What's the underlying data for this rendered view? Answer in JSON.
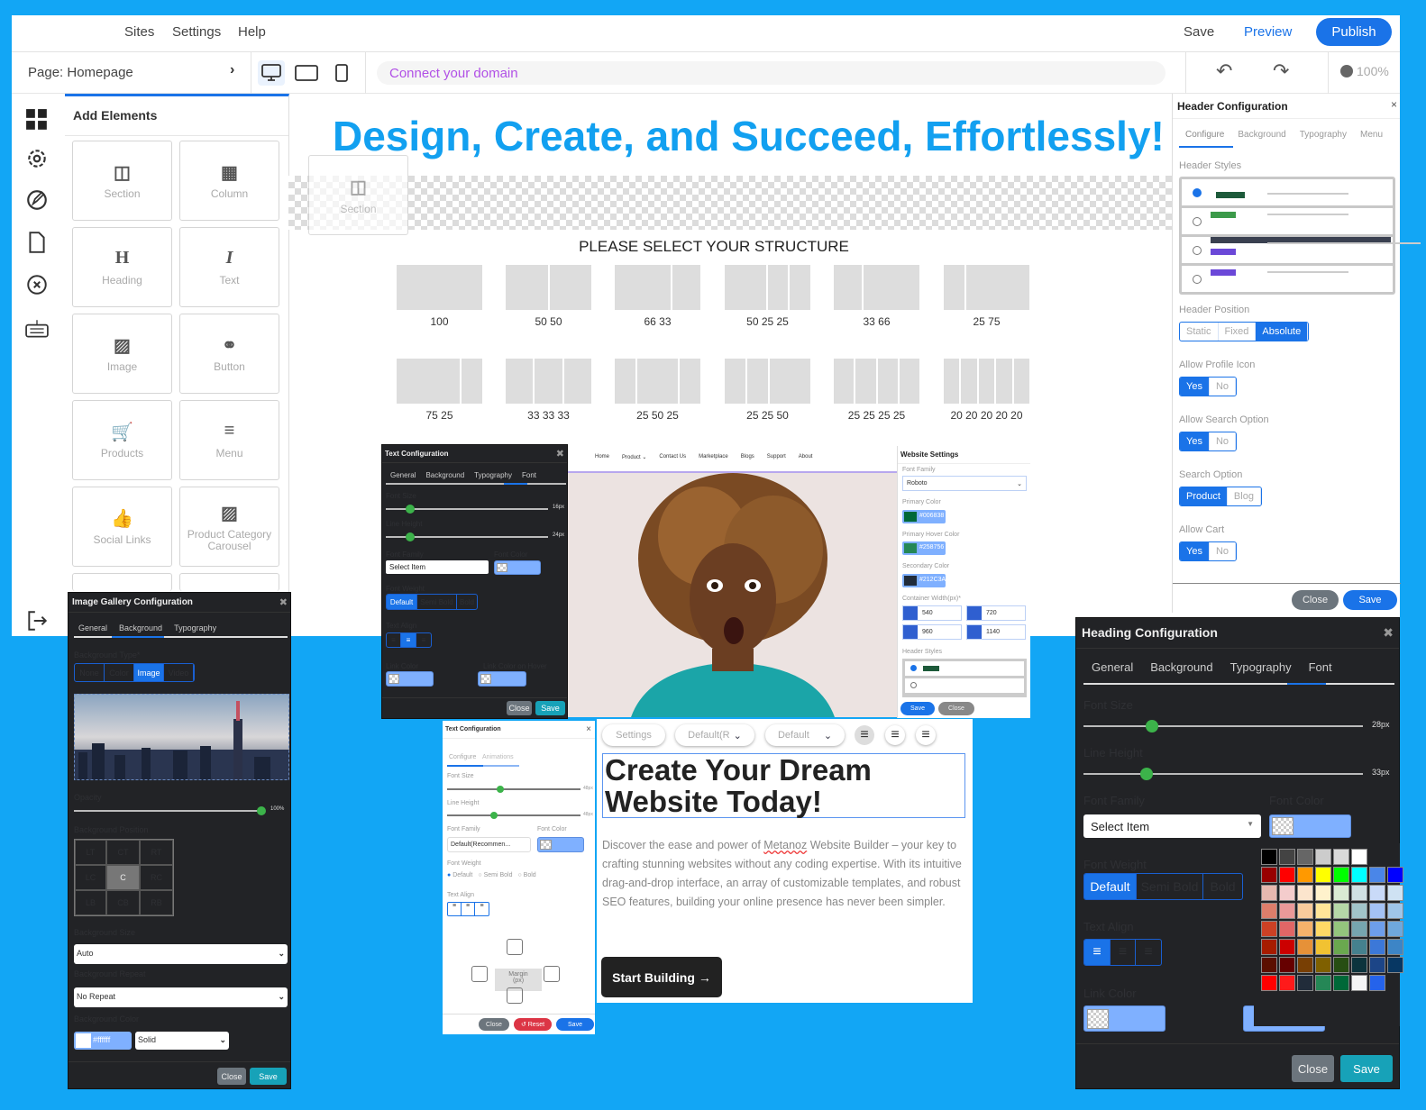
{
  "colors": {
    "background": "#12a6f5",
    "accent": "#1a73e8",
    "heading": "#12a0f0",
    "domain_text": "#b150e6"
  },
  "topbar": {
    "menu": [
      "Sites",
      "Settings",
      "Help"
    ],
    "save": "Save",
    "preview": "Preview",
    "publish": "Publish"
  },
  "secbar": {
    "page": "Page: Homepage",
    "domain": "Connect your domain",
    "zoom": "100%"
  },
  "add_elements": {
    "title": "Add Elements",
    "tiles": [
      {
        "label": "Section",
        "icon": "section-icon",
        "glyph": "◫"
      },
      {
        "label": "Column",
        "icon": "column-icon",
        "glyph": "▦"
      },
      {
        "label": "Heading",
        "icon": "heading-icon",
        "glyph": "H"
      },
      {
        "label": "Text",
        "icon": "text-icon",
        "glyph": "I"
      },
      {
        "label": "Image",
        "icon": "image-icon",
        "glyph": "▨"
      },
      {
        "label": "Button",
        "icon": "link-icon",
        "glyph": "⚭"
      },
      {
        "label": "Products",
        "icon": "cart-icon",
        "glyph": "🛒"
      },
      {
        "label": "Menu",
        "icon": "menu-icon",
        "glyph": "≡"
      },
      {
        "label": "Social Links",
        "icon": "thumbs-up-icon",
        "glyph": "👍"
      },
      {
        "label": "Product Category Carousel",
        "icon": "images-icon",
        "glyph": "▨"
      }
    ]
  },
  "canvas": {
    "headline": "Design, Create, and Succeed, Effortlessly!",
    "ghost_section": "Section",
    "structure_title": "PLEASE SELECT YOUR STRUCTURE",
    "structures": [
      {
        "label": "100",
        "cols": [
          100
        ]
      },
      {
        "label": "50 50",
        "cols": [
          50,
          50
        ]
      },
      {
        "label": "66 33",
        "cols": [
          66,
          33
        ]
      },
      {
        "label": "50 25 25",
        "cols": [
          50,
          25,
          25
        ]
      },
      {
        "label": "33 66",
        "cols": [
          33,
          66
        ]
      },
      {
        "label": "25 75",
        "cols": [
          25,
          75
        ]
      },
      {
        "label": "75 25",
        "cols": [
          75,
          25
        ]
      },
      {
        "label": "33 33 33",
        "cols": [
          33,
          33,
          33
        ]
      },
      {
        "label": "25 50 25",
        "cols": [
          25,
          50,
          25
        ]
      },
      {
        "label": "25 25 50",
        "cols": [
          25,
          25,
          50
        ]
      },
      {
        "label": "25 25 25 25",
        "cols": [
          25,
          25,
          25,
          25
        ]
      },
      {
        "label": "20 20 20 20 20",
        "cols": [
          20,
          20,
          20,
          20,
          20
        ]
      }
    ]
  },
  "text_config_dark": {
    "title": "Text Configuration",
    "tabs": [
      "General",
      "Background",
      "Typography",
      "Font"
    ],
    "active_tab": "Font",
    "font_size_label": "Font Size",
    "font_size": "16px",
    "line_height_label": "Line Height",
    "line_height": "24px",
    "font_family_label": "Font Family",
    "font_family": "Select Item",
    "font_color_label": "Font Color",
    "font_weight_label": "Font Weight",
    "weights": [
      "Default",
      "Semi Bold",
      "Bold"
    ],
    "text_align_label": "Text Align",
    "link_color_label": "Link Color",
    "link_hover_label": "Link Color on Hover",
    "close": "Close",
    "save": "Save"
  },
  "preview_nav": [
    "Home",
    "Product ⌄",
    "Contact Us",
    "Marketplace",
    "Blogs",
    "Support",
    "About"
  ],
  "website_settings": {
    "title": "Website Settings",
    "font_family_label": "Font Family",
    "font_family": "Roboto",
    "primary_label": "Primary Color",
    "primary": "#006838",
    "hover_label": "Primary Hover Color",
    "hover": "#258756",
    "secondary_label": "Secondary Color",
    "secondary": "#212C3A",
    "container_label": "Container Width(px)*",
    "widths": [
      "540",
      "720",
      "960",
      "1140"
    ],
    "header_styles_label": "Header Styles",
    "save": "Save",
    "close": "Close"
  },
  "gallery_config": {
    "title": "Image Gallery Configuration",
    "tabs": [
      "General",
      "Background",
      "Typography"
    ],
    "active_tab": "Background",
    "bg_type_label": "Background Type*",
    "bg_types": [
      "None",
      "Color",
      "Image",
      "Video"
    ],
    "bg_type": "Image",
    "opacity_label": "Opacity",
    "opacity": "100%",
    "position_label": "Background Position",
    "positions": [
      "LT",
      "CT",
      "RT",
      "LC",
      "C",
      "RC",
      "LB",
      "CB",
      "RB"
    ],
    "position": "C",
    "size_label": "Background Size",
    "size": "Auto",
    "repeat_label": "Background Repeat",
    "repeat": "No Repeat",
    "color_label": "Background Color",
    "color": "#ffffff",
    "color_style": "Solid",
    "close": "Close",
    "save": "Save"
  },
  "text_config_light": {
    "title": "Text Configuration",
    "tabs": [
      "Configure",
      "Animations"
    ],
    "font_size_label": "Font Size",
    "font_size": "48px",
    "line_height_label": "Line Height",
    "line_height": "48px",
    "font_family_label": "Font Family",
    "font_family": "Default(Recommen...",
    "font_color_label": "Font Color",
    "font_weight_label": "Font Weight",
    "weights": [
      "Default",
      "Semi Bold",
      "Bold"
    ],
    "text_align_label": "Text Align",
    "margin": "Margin",
    "margin_unit": "(px)",
    "close": "Close",
    "reset": "Reset",
    "save": "Save"
  },
  "hero": {
    "toolbar": {
      "settings": "Settings",
      "font": "Default(R",
      "weight": "Default"
    },
    "title": "Create Your Dream Website Today!",
    "body_pre": "Discover the ease and power of ",
    "brand": "Metanoz",
    "body_post": " Website Builder – your key to crafting stunning websites without any coding expertise. With its intuitive drag-and-drop interface, an array of customizable templates, and robust SEO features, building your online presence has never been simpler.",
    "cta": "Start Building"
  },
  "header_config": {
    "title": "Header Configuration",
    "tabs": [
      "Configure",
      "Background",
      "Typography",
      "Menu"
    ],
    "styles_label": "Header Styles",
    "position_label": "Header Position",
    "positions": [
      "Static",
      "Fixed",
      "Absolute"
    ],
    "position": "Absolute",
    "profile_label": "Allow Profile Icon",
    "search_label": "Allow Search Option",
    "search_option_label": "Search Option",
    "search_options": [
      "Product",
      "Blog"
    ],
    "cart_label": "Allow Cart",
    "yes": "Yes",
    "no": "No",
    "close": "Close",
    "save": "Save"
  },
  "heading_config": {
    "title": "Heading Configuration",
    "tabs": [
      "General",
      "Background",
      "Typography",
      "Font"
    ],
    "font_size_label": "Font Size",
    "font_size": "28px",
    "line_height_label": "Line Height",
    "line_height": "33px",
    "font_family_label": "Font Family",
    "font_family": "Select Item",
    "font_color_label": "Font Color",
    "font_weight_label": "Font Weight",
    "weights": [
      "Default",
      "Semi Bold",
      "Bold"
    ],
    "text_align_label": "Text Align",
    "link_color_label": "Link Color",
    "close": "Close",
    "save": "Save",
    "palette": [
      "#000000",
      "#434343",
      "#666666",
      "#cccccc",
      "#d9d9d9",
      "#ffffff",
      "",
      "",
      "#980000",
      "#ff0000",
      "#ff9900",
      "#ffff00",
      "#00ff00",
      "#00ffff",
      "#4a86e8",
      "#0000ff",
      "#e6b8af",
      "#f4cccc",
      "#fce5cd",
      "#fff2cc",
      "#d9ead3",
      "#d0e0e3",
      "#c9daf8",
      "#cfe2f3",
      "#dd7e6b",
      "#ea9999",
      "#f9cb9c",
      "#ffe599",
      "#b6d7a8",
      "#a2c4c9",
      "#a4c2f4",
      "#9fc5e8",
      "#cc4125",
      "#e06666",
      "#f6b26b",
      "#ffd966",
      "#93c47d",
      "#76a5af",
      "#6d9eeb",
      "#6fa8dc",
      "#a61c00",
      "#cc0000",
      "#e69138",
      "#f1c232",
      "#6aa84f",
      "#45818e",
      "#3c78d8",
      "#3d85c6",
      "#5b0f00",
      "#660000",
      "#783f04",
      "#7f6000",
      "#274e13",
      "#0c343d",
      "#1c4587",
      "#073763",
      "#ff0000",
      "#ff1a1a",
      "#212c3a",
      "#258756",
      "#006838",
      "#f5f5f5",
      "#2563eb",
      ""
    ]
  }
}
